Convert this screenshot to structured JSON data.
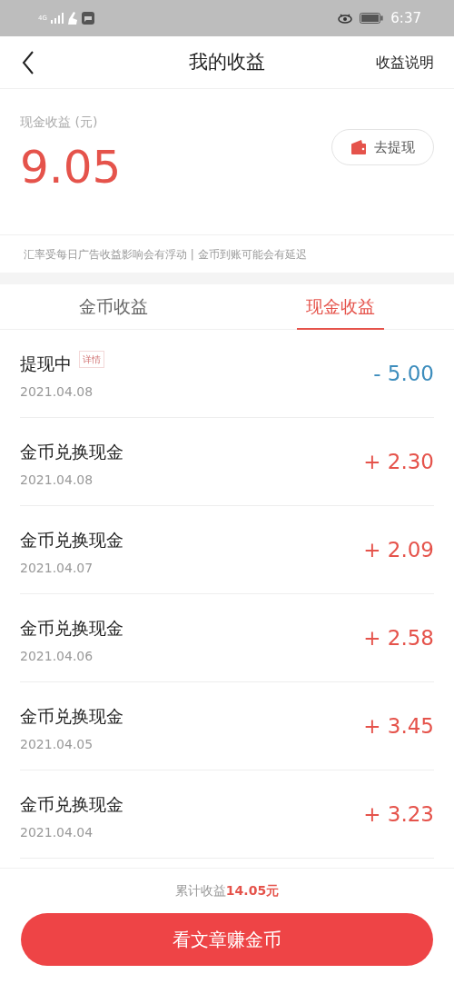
{
  "status_bar": {
    "network": "4G",
    "time": "6:37"
  },
  "header": {
    "title": "我的收益",
    "action": "收益说明"
  },
  "summary": {
    "label": "现金收益 (元)",
    "amount": "9.05",
    "withdraw_button": "去提现"
  },
  "notice": "汇率受每日广告收益影响会有浮动 | 金币到账可能会有延迟",
  "tabs": [
    {
      "label": "金币收益",
      "selected": false
    },
    {
      "label": "现金收益",
      "selected": true
    }
  ],
  "records": [
    {
      "title": "提现中",
      "tag": "详情",
      "date": "2021.04.08",
      "amount": "- 5.00",
      "kind": "expense"
    },
    {
      "title": "金币兑换现金",
      "date": "2021.04.08",
      "amount": "+ 2.30",
      "kind": "income"
    },
    {
      "title": "金币兑换现金",
      "date": "2021.04.07",
      "amount": "+ 2.09",
      "kind": "income"
    },
    {
      "title": "金币兑换现金",
      "date": "2021.04.06",
      "amount": "+ 2.58",
      "kind": "income"
    },
    {
      "title": "金币兑换现金",
      "date": "2021.04.05",
      "amount": "+ 3.45",
      "kind": "income"
    },
    {
      "title": "金币兑换现金",
      "date": "2021.04.04",
      "amount": "+ 3.23",
      "kind": "income"
    }
  ],
  "footer": {
    "total_label": "累计收益",
    "total_amount": "14.05元",
    "button": "看文章赚金币"
  }
}
